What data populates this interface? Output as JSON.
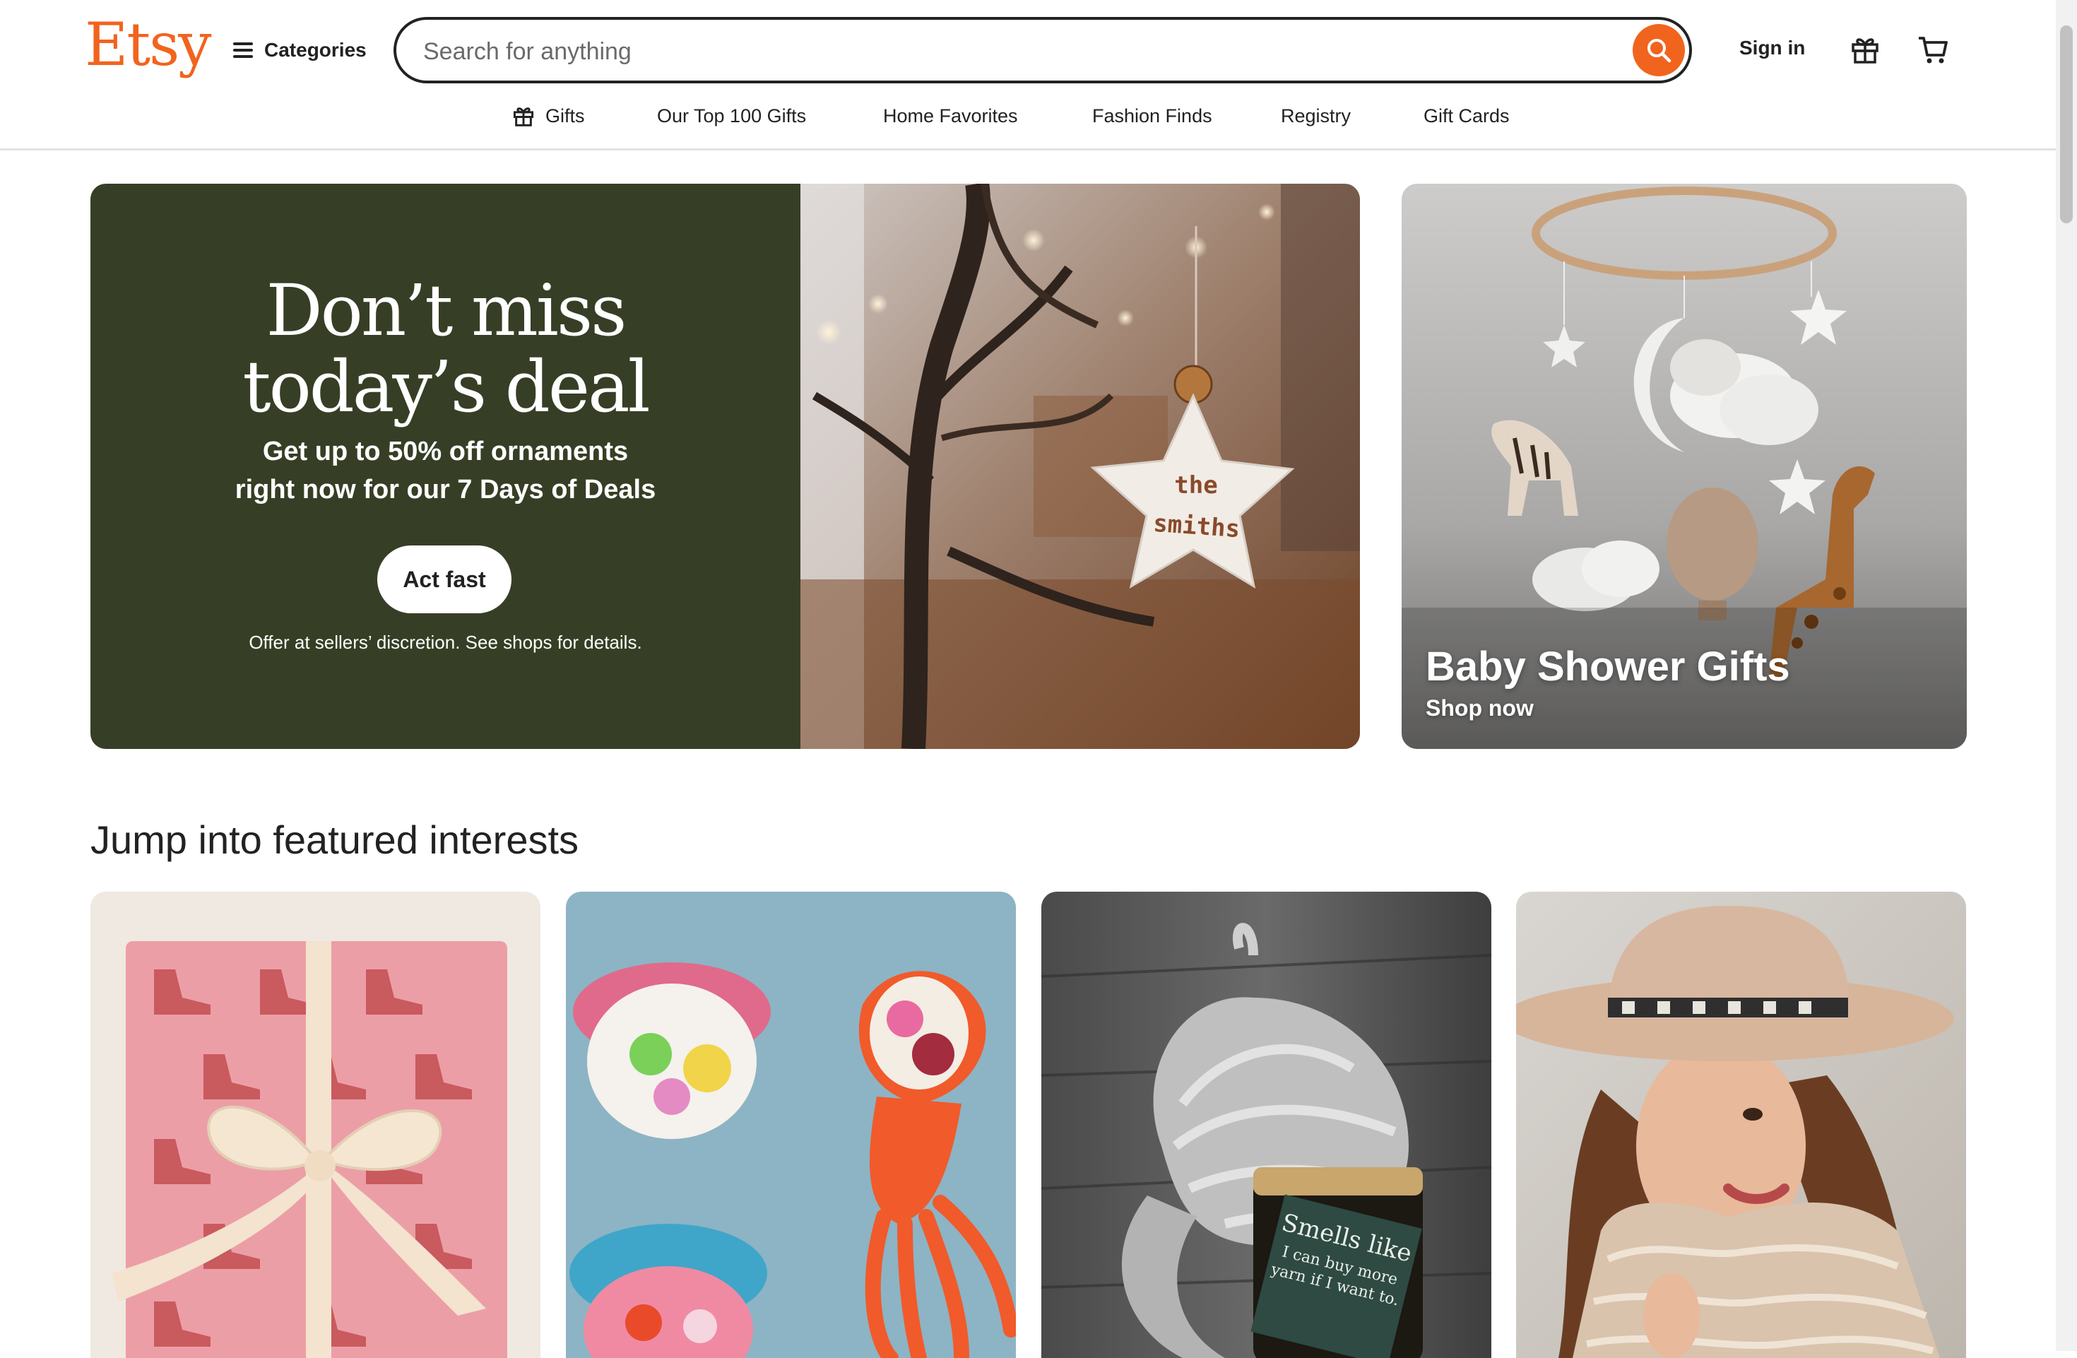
{
  "header": {
    "logo": "Etsy",
    "categories_label": "Categories",
    "search_placeholder": "Search for anything",
    "signin_label": "Sign in"
  },
  "nav": [
    {
      "label": "Gifts"
    },
    {
      "label": "Our Top 100 Gifts"
    },
    {
      "label": "Home Favorites"
    },
    {
      "label": "Fashion Finds"
    },
    {
      "label": "Registry"
    },
    {
      "label": "Gift Cards"
    }
  ],
  "hero": {
    "title_line1": "Don’t miss",
    "title_line2": "today’s deal",
    "subtitle_line1": "Get up to 50% off ornaments",
    "subtitle_line2": "right now for our 7 Days of Deals",
    "button_label": "Act fast",
    "note": "Offer at sellers’ discretion. See shops for details.",
    "ornament_text_1": "the",
    "ornament_text_2": "smiths"
  },
  "side_promo": {
    "title": "Baby Shower Gifts",
    "link": "Shop now"
  },
  "featured": {
    "title": "Jump into featured interests",
    "candle_text_1": "Smells like",
    "candle_text_2": "I can buy more",
    "candle_text_3": "yarn if I want to."
  },
  "colors": {
    "brand": "#f1641e",
    "hero_bg": "#363f25",
    "text": "#222222"
  }
}
